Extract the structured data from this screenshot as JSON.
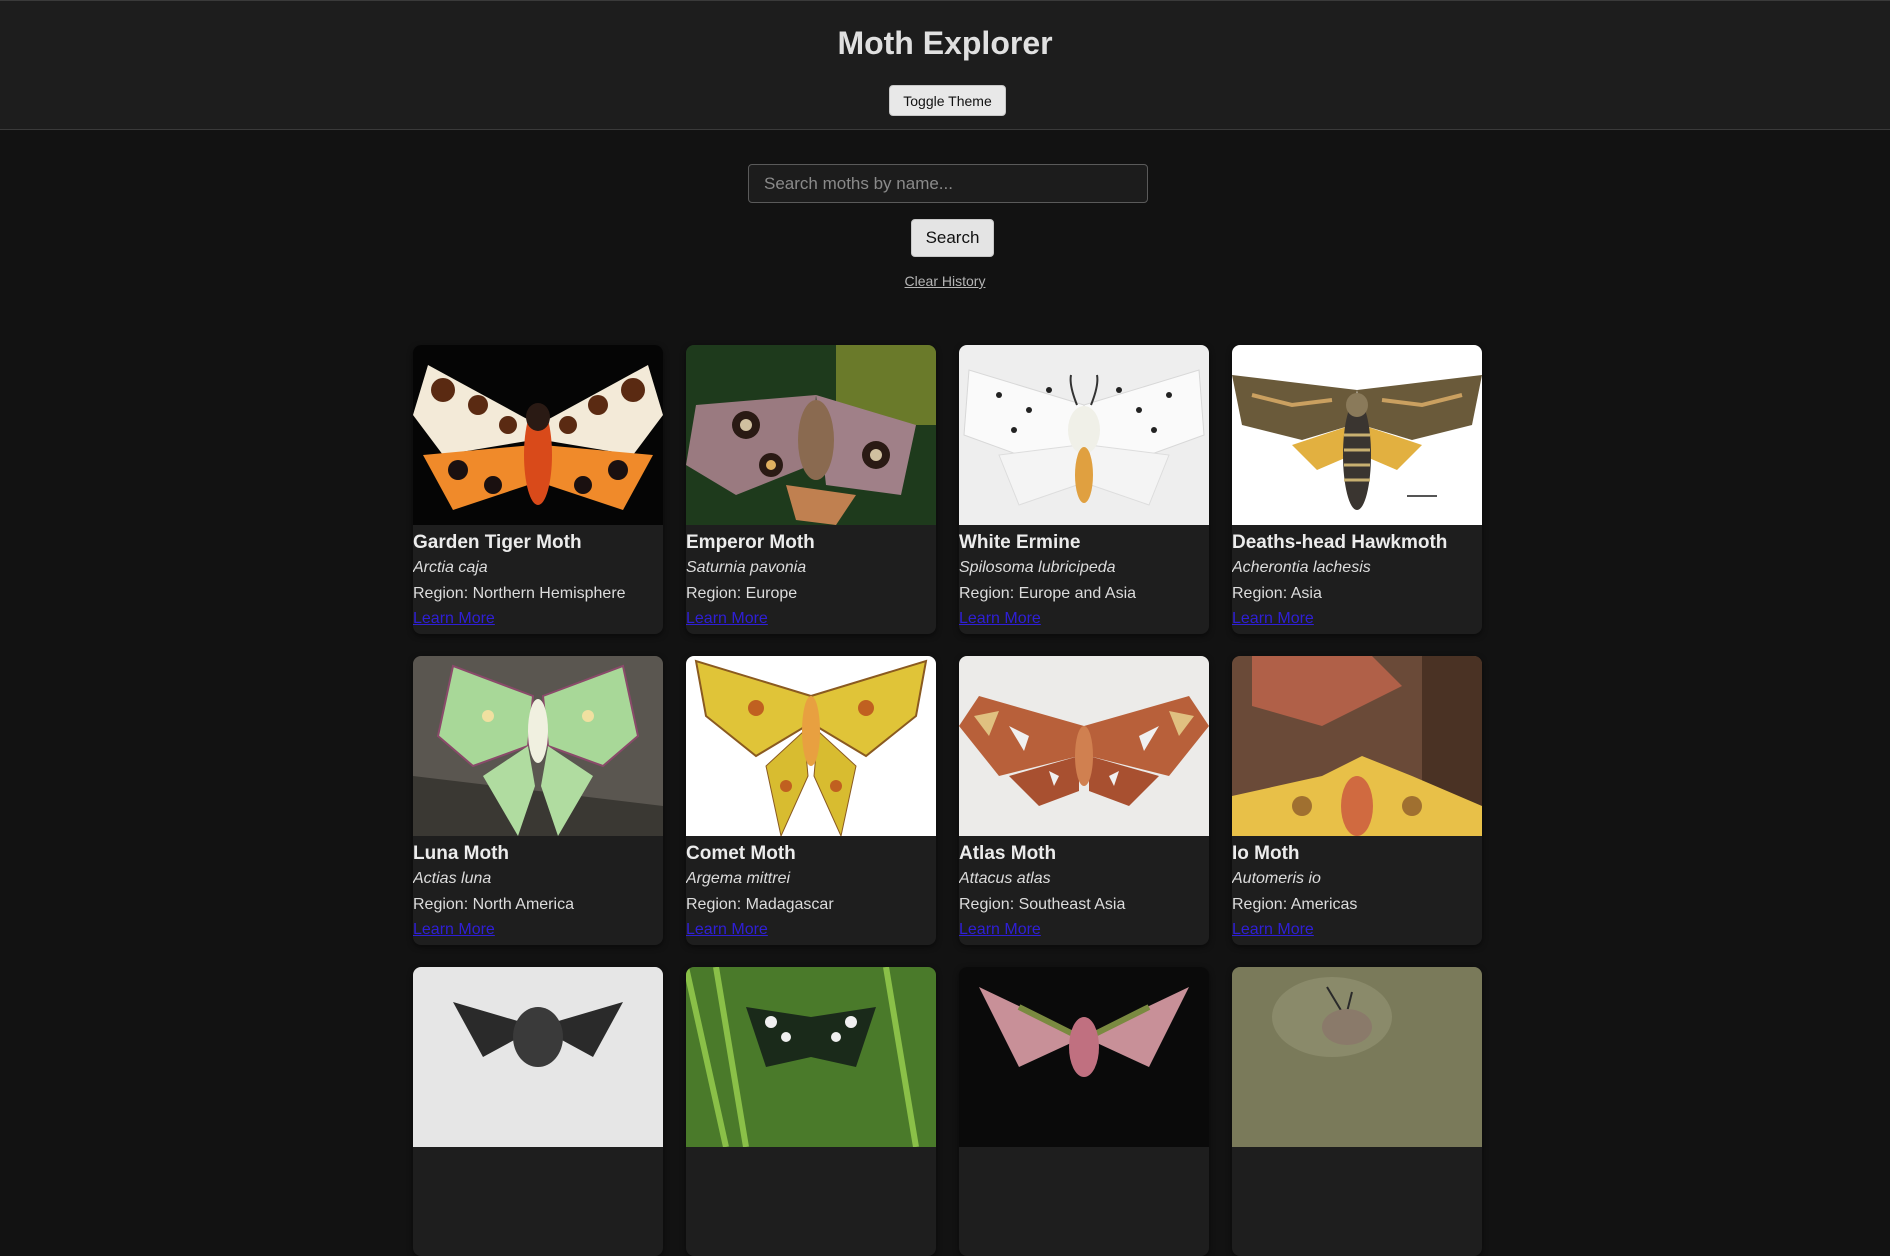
{
  "header": {
    "title": "Moth Explorer",
    "toggle_label": "Toggle Theme"
  },
  "search": {
    "placeholder": "Search moths by name...",
    "value": "",
    "button_label": "Search",
    "clear_label": "Clear History"
  },
  "colors": {
    "background": "#121212",
    "header_bg": "#1d1d1d",
    "card_bg": "#1e1e1e",
    "link": "#2f1fd6"
  },
  "moths": [
    {
      "name": "Garden Tiger Moth",
      "scientific": "Arctia caja",
      "region": "Region: Northern Hemisphere",
      "link": "Learn More"
    },
    {
      "name": "Emperor Moth",
      "scientific": "Saturnia pavonia",
      "region": "Region: Europe",
      "link": "Learn More"
    },
    {
      "name": "White Ermine",
      "scientific": "Spilosoma lubricipeda",
      "region": "Region: Europe and Asia",
      "link": "Learn More"
    },
    {
      "name": "Deaths-head Hawkmoth",
      "scientific": "Acherontia lachesis",
      "region": "Region: Asia",
      "link": "Learn More"
    },
    {
      "name": "Luna Moth",
      "scientific": "Actias luna",
      "region": "Region: North America",
      "link": "Learn More"
    },
    {
      "name": "Comet Moth",
      "scientific": "Argema mittrei",
      "region": "Region: Madagascar",
      "link": "Learn More"
    },
    {
      "name": "Atlas Moth",
      "scientific": "Attacus atlas",
      "region": "Region: Southeast Asia",
      "link": "Learn More"
    },
    {
      "name": "Io Moth",
      "scientific": "Automeris io",
      "region": "Region: Americas",
      "link": "Learn More"
    }
  ]
}
